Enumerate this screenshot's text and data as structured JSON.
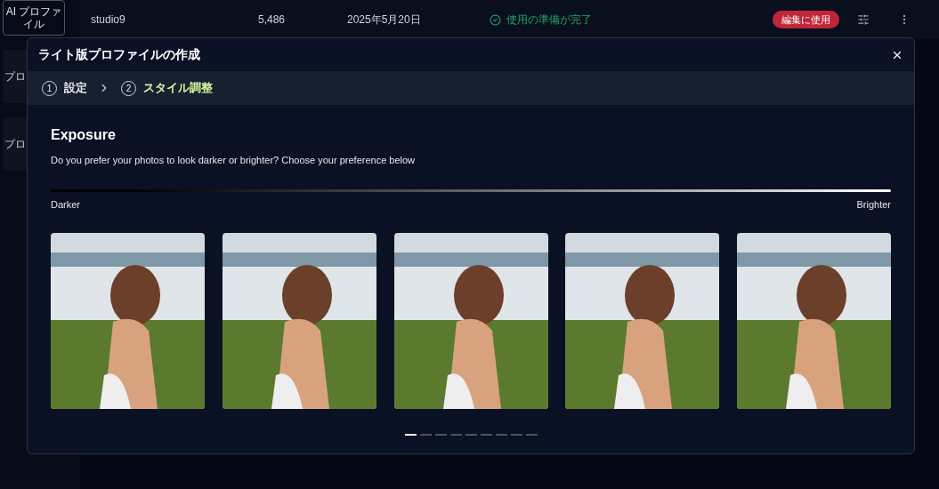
{
  "sidebar": {
    "items": [
      {
        "label": "AI プロファイル",
        "selected": true
      },
      {
        "label": "プロ",
        "selected": false
      },
      {
        "label": "プロ",
        "selected": false
      }
    ]
  },
  "table_row": {
    "name": "studio9",
    "count": "5,486",
    "date": "2025年5月20日",
    "status": "使用の準備が完了",
    "action": "編集に使用"
  },
  "dialog": {
    "title": "ライト版プロファイルの作成",
    "steps": [
      {
        "number": "1",
        "label": "設定",
        "selected": false
      },
      {
        "number": "2",
        "label": "スタイル調整",
        "selected": true
      }
    ],
    "heading": "Exposure",
    "description": "Do you prefer your photos to look darker or brighter? Choose your preference below",
    "scale": {
      "left": "Darker",
      "right": "Brighter"
    },
    "pages": [
      {
        "selected": true
      },
      {
        "selected": false
      },
      {
        "selected": false
      },
      {
        "selected": false
      },
      {
        "selected": false
      },
      {
        "selected": false
      },
      {
        "selected": false
      },
      {
        "selected": false
      },
      {
        "selected": false
      }
    ]
  }
}
